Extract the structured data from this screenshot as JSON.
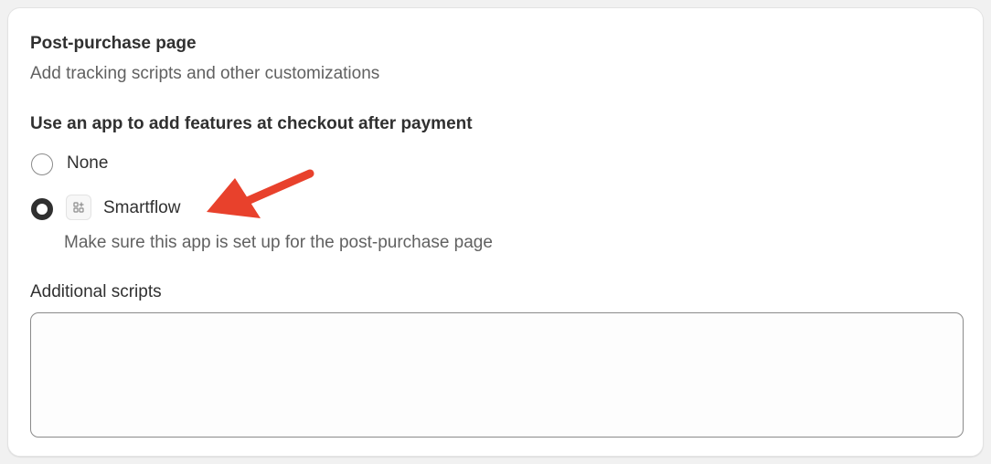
{
  "card": {
    "title": "Post-purchase page",
    "subtitle": "Add tracking scripts and other customizations"
  },
  "app_selection": {
    "label": "Use an app to add features at checkout after payment",
    "options": [
      {
        "label": "None",
        "selected": false
      },
      {
        "label": "Smartflow",
        "selected": true,
        "icon": "app-grid-icon"
      }
    ],
    "help_text": "Make sure this app is set up for the post-purchase page"
  },
  "additional_scripts": {
    "label": "Additional scripts",
    "value": "",
    "placeholder": ""
  },
  "annotation": {
    "icon": "red-arrow-icon",
    "color": "#e8412c"
  },
  "colors": {
    "text": "#303030",
    "subdued": "#616161",
    "border": "#8a8a8a"
  }
}
